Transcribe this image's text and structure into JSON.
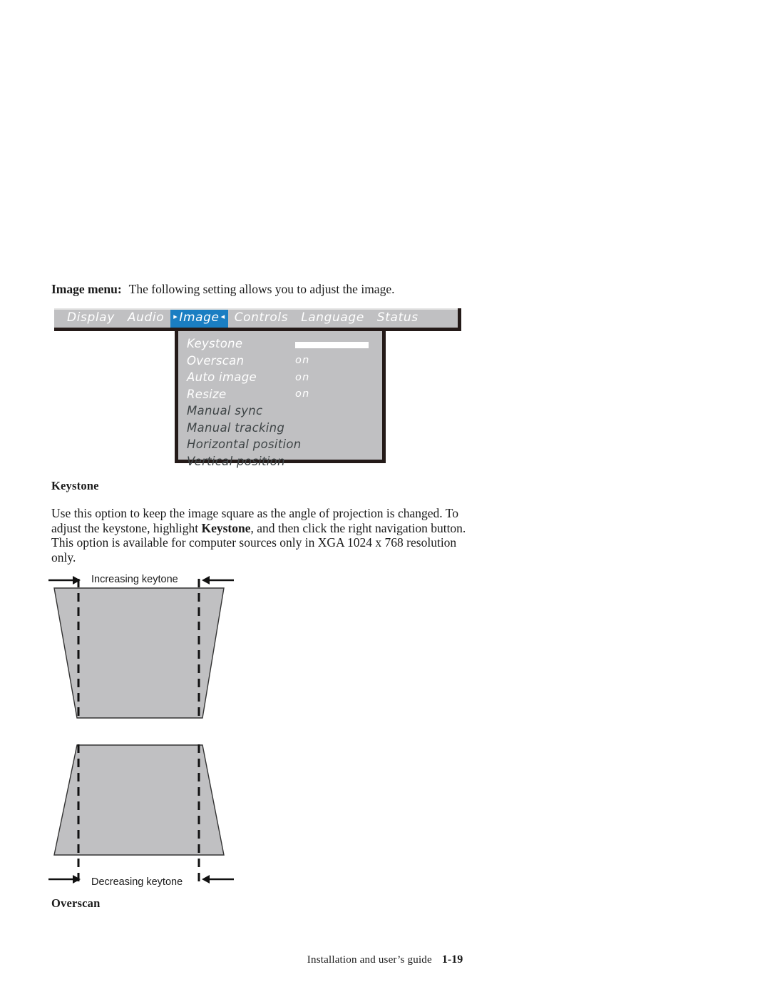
{
  "intro": {
    "lead": "Image menu:",
    "rest": "The following setting allows you to adjust the image."
  },
  "osd": {
    "tabs": [
      {
        "label": "Display",
        "selected": false
      },
      {
        "label": "Audio",
        "selected": false
      },
      {
        "label": "Image",
        "selected": true
      },
      {
        "label": "Controls",
        "selected": false
      },
      {
        "label": "Language",
        "selected": false
      },
      {
        "label": "Status",
        "selected": false
      }
    ],
    "selected_tab_left_marker": "▸",
    "selected_tab_right_marker": "◂",
    "highlight_color": "#1a7ec2",
    "panel_bg_color": "#c0c0c2",
    "menu_items": [
      {
        "label": "Keystone",
        "value": "",
        "control": "slider",
        "state": "on"
      },
      {
        "label": "Overscan",
        "value": "on",
        "control": "text",
        "state": "on"
      },
      {
        "label": "Auto image",
        "value": "on",
        "control": "text",
        "state": "on"
      },
      {
        "label": "Resize",
        "value": "on",
        "control": "text",
        "state": "on"
      },
      {
        "label": "Manual sync",
        "value": "",
        "control": "none",
        "state": "off"
      },
      {
        "label": "Manual tracking",
        "value": "",
        "control": "none",
        "state": "off"
      },
      {
        "label": "Horizontal position",
        "value": "",
        "control": "none",
        "state": "off"
      },
      {
        "label": "Vertical position",
        "value": "",
        "control": "none",
        "state": "off"
      }
    ]
  },
  "sections": {
    "keystone_heading": "Keystone",
    "overscan_heading": "Overscan",
    "keystone_body_part1": "Use this option to keep the image square as the angle of projection is changed. To adjust the keystone, highlight ",
    "keystone_body_bold": "Keystone",
    "keystone_body_part2": ", and then click the right navigation button. This option is available for computer sources only in XGA 1024 x 768 resolution only."
  },
  "figures": {
    "caption_top": "Increasing keytone",
    "caption_bottom": "Decreasing keytone",
    "fill_color": "#c0c0c2",
    "stroke_color": "#333333"
  },
  "footer": {
    "note": "Installation and user’s guide",
    "page": "1-19"
  }
}
